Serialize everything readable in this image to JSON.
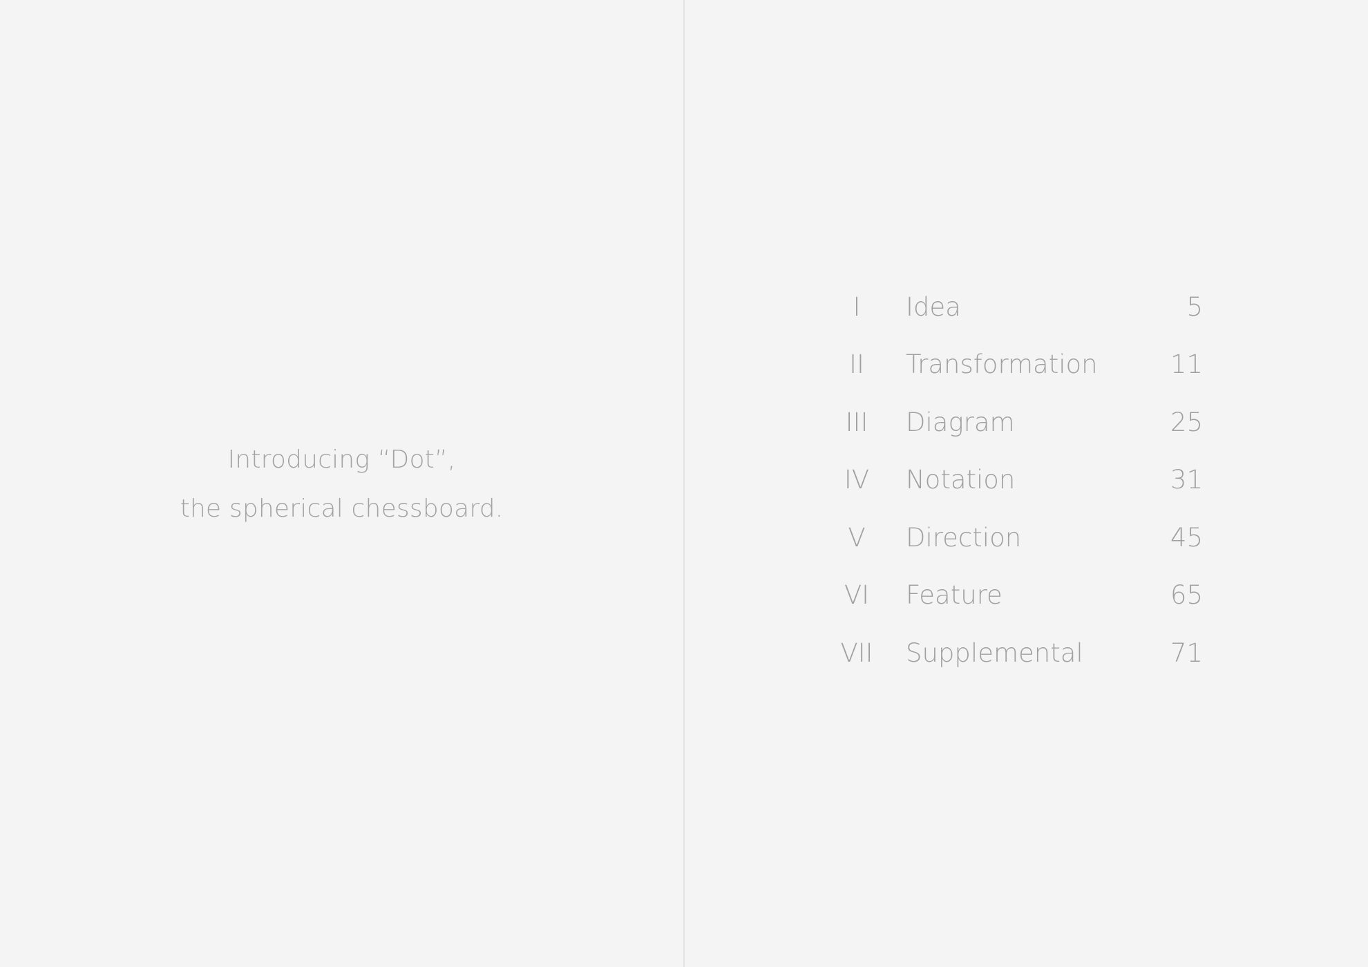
{
  "intro": {
    "line1": "Introducing “Dot”,",
    "line2": "the spherical chessboard."
  },
  "toc": {
    "entries": [
      {
        "numeral": "I",
        "title": "Idea",
        "page": "5"
      },
      {
        "numeral": "II",
        "title": "Transformation",
        "page": "11"
      },
      {
        "numeral": "III",
        "title": "Diagram",
        "page": "25"
      },
      {
        "numeral": "IV",
        "title": "Notation",
        "page": "31"
      },
      {
        "numeral": "V",
        "title": "Direction",
        "page": "45"
      },
      {
        "numeral": "VI",
        "title": "Feature",
        "page": "65"
      },
      {
        "numeral": "VII",
        "title": "Supplemental",
        "page": "71"
      }
    ]
  },
  "colors": {
    "background": "#f4f4f4",
    "text": "#a0a0a0",
    "gutter": "#e2e2e2"
  }
}
